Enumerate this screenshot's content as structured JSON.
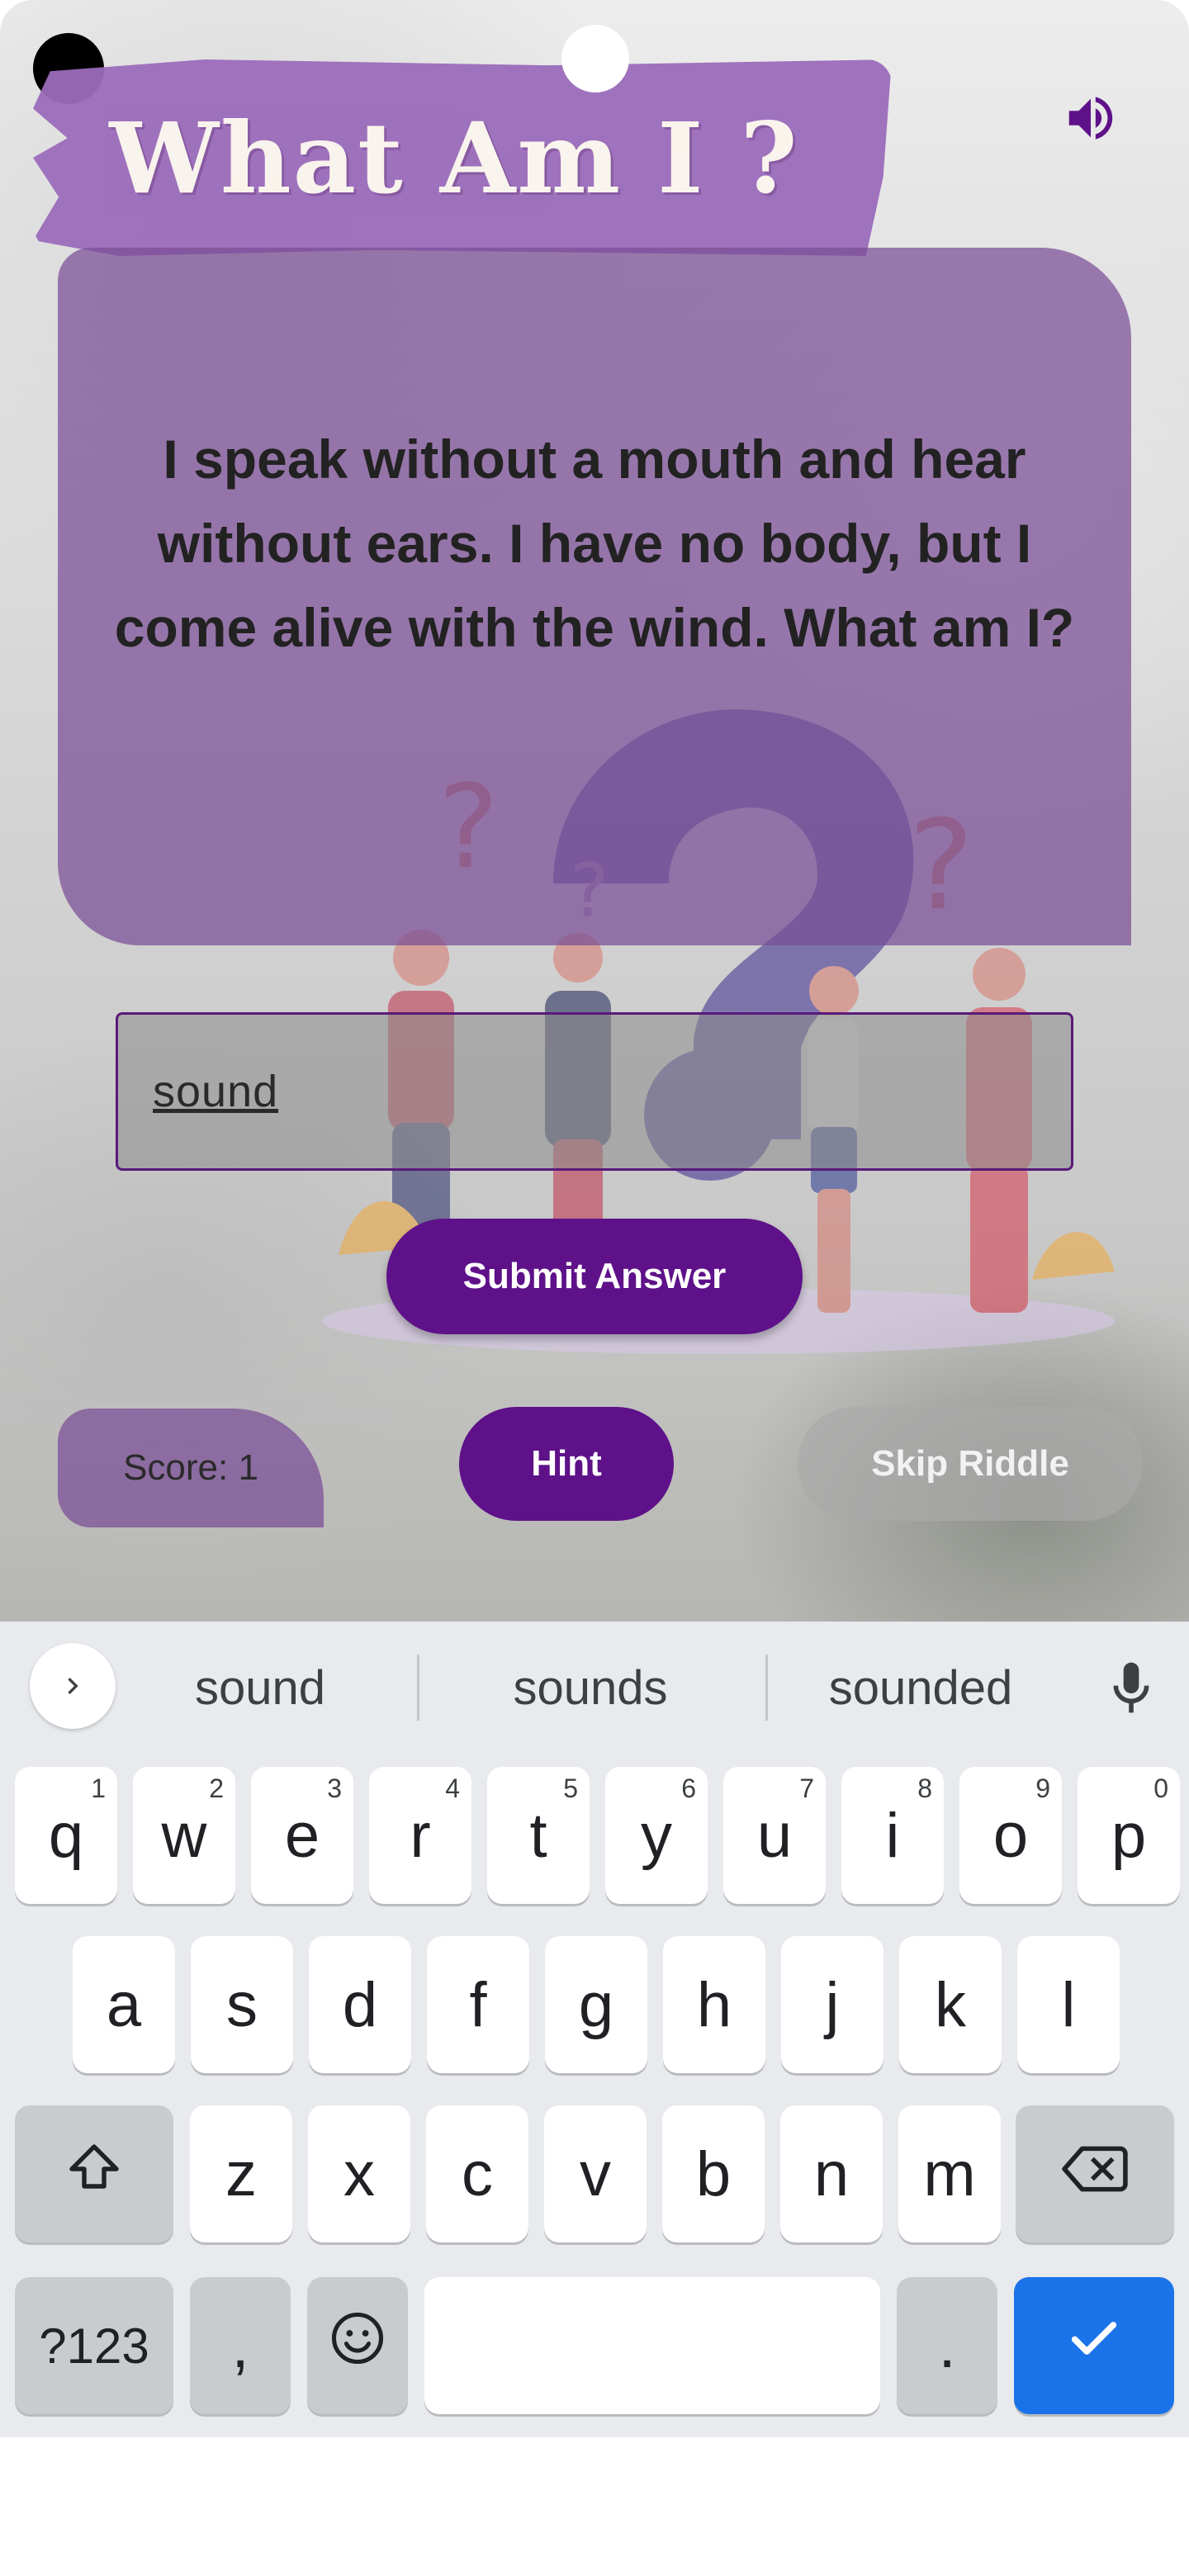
{
  "app": {
    "title": "What Am I ?",
    "riddle": "I speak without a mouth and hear without ears. I have no body, but I come alive with the wind. What am I?",
    "answer_value": "sound",
    "submit_label": "Submit Answer",
    "score_label": "Score: 1",
    "hint_label": "Hint",
    "skip_label": "Skip Riddle",
    "speaker_icon": "volume-icon",
    "colors": {
      "accent": "#5e1189",
      "banner": "#9b6cbb",
      "card": "#7a4e96"
    }
  },
  "keyboard": {
    "suggestions": [
      "sound",
      "sounds",
      "sounded"
    ],
    "row1": [
      {
        "k": "q",
        "n": "1"
      },
      {
        "k": "w",
        "n": "2"
      },
      {
        "k": "e",
        "n": "3"
      },
      {
        "k": "r",
        "n": "4"
      },
      {
        "k": "t",
        "n": "5"
      },
      {
        "k": "y",
        "n": "6"
      },
      {
        "k": "u",
        "n": "7"
      },
      {
        "k": "i",
        "n": "8"
      },
      {
        "k": "o",
        "n": "9"
      },
      {
        "k": "p",
        "n": "0"
      }
    ],
    "row2": [
      "a",
      "s",
      "d",
      "f",
      "g",
      "h",
      "j",
      "k",
      "l"
    ],
    "row3": [
      "z",
      "x",
      "c",
      "v",
      "b",
      "n",
      "m"
    ],
    "symbols_label": "?123",
    "comma_label": ",",
    "period_label": ".",
    "icons": {
      "shift": "shift-icon",
      "backspace": "backspace-icon",
      "emoji": "emoji-icon",
      "enter": "check-icon",
      "mic": "mic-icon",
      "expand": "chevron-right-icon"
    }
  }
}
